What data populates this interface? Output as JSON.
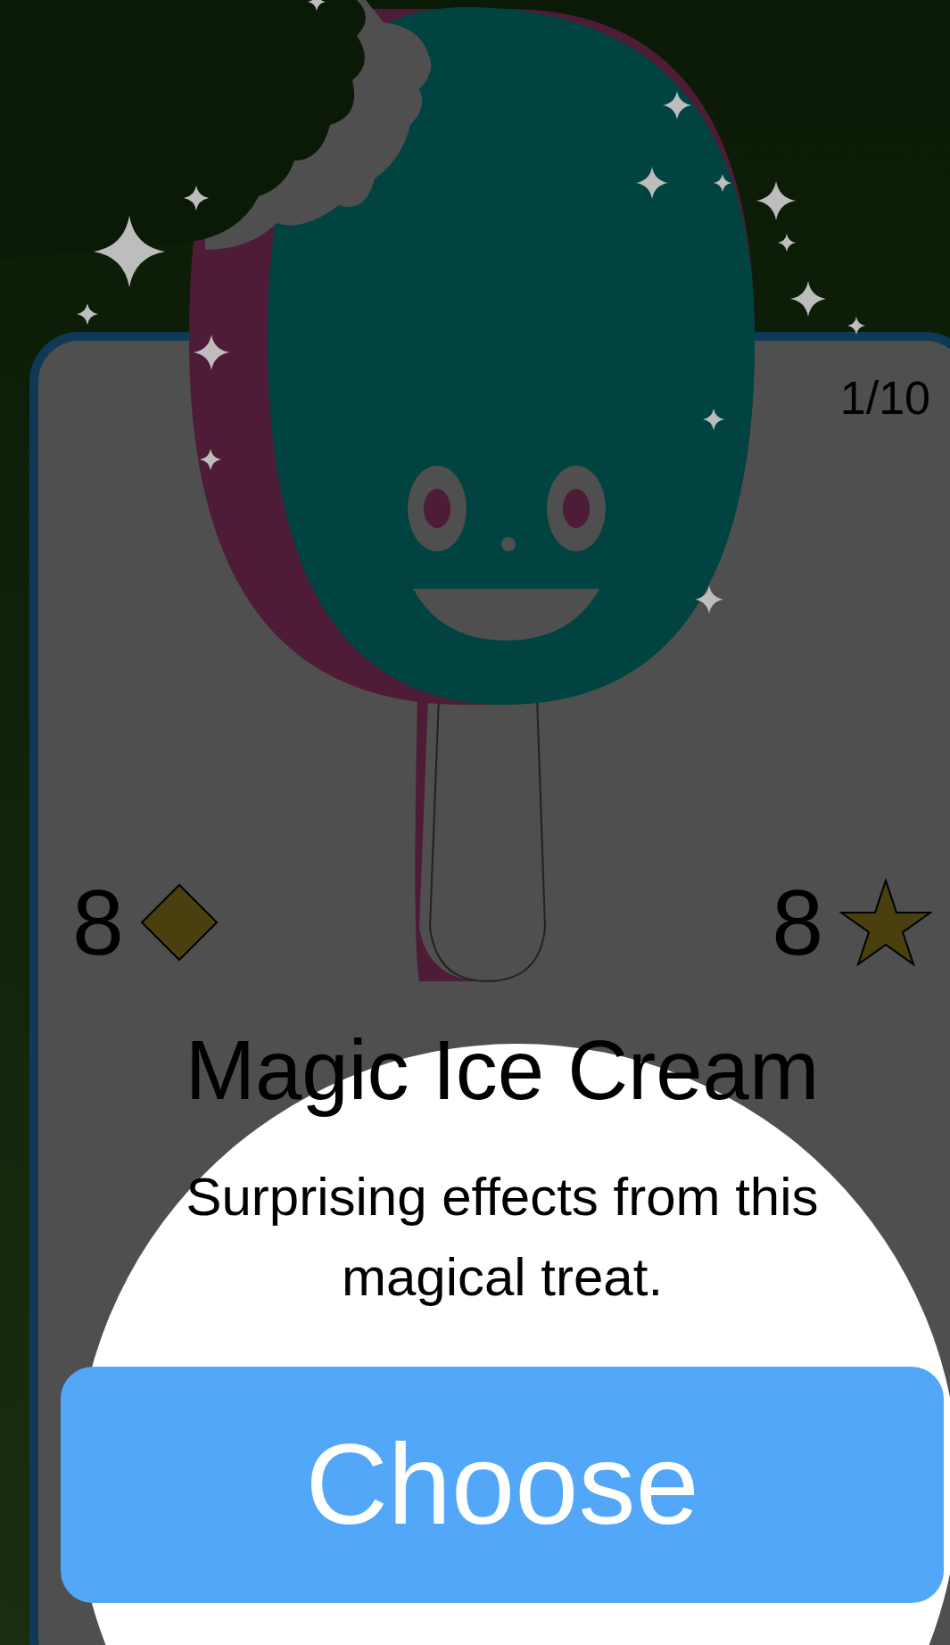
{
  "card": {
    "counter": "1/10",
    "stats": [
      {
        "kind": "diamond",
        "value": "8"
      },
      {
        "kind": "star",
        "value": "8"
      }
    ],
    "title": "Magic Ice Cream",
    "description": "Surprising effects from this magical treat.",
    "button": "Choose"
  }
}
